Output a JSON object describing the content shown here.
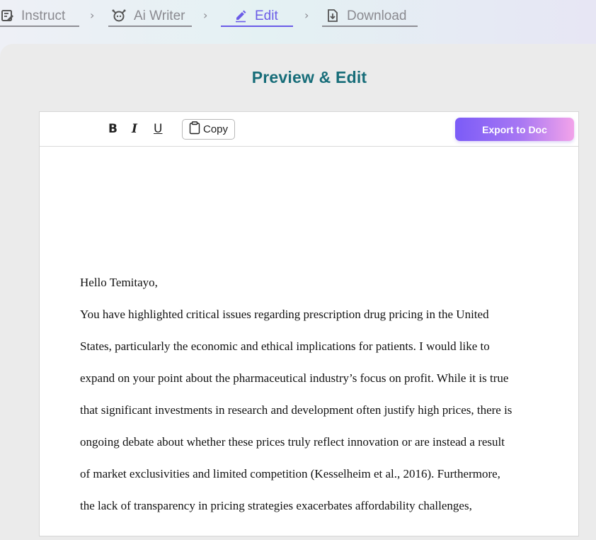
{
  "stepper": {
    "steps": [
      {
        "label": "Instruct",
        "icon": "edit-document-icon",
        "state": "done"
      },
      {
        "label": "Ai Writer",
        "icon": "robot-icon",
        "state": "done"
      },
      {
        "label": "Edit",
        "icon": "pencil-icon",
        "state": "active"
      },
      {
        "label": "Download",
        "icon": "download-document-icon",
        "state": "pending"
      }
    ],
    "separator": "›"
  },
  "page": {
    "title": "Preview & Edit"
  },
  "toolbar": {
    "bold_label": "B",
    "italic_label": "I",
    "underline_label": "U",
    "copy_label": "Copy",
    "export_label": "Export to Doc"
  },
  "document": {
    "greeting": "Hello Temitayo,",
    "lines": [
      "You have highlighted critical issues regarding prescription drug pricing in the United",
      "States, particularly the economic and ethical implications for patients. I would like to",
      "expand on your point about the pharmaceutical industry’s focus on profit. While it is true",
      "that significant investments in research and development often justify high prices, there is",
      "ongoing debate about whether these prices truly reflect innovation or are instead a result",
      "of market exclusivities and limited competition (Kesselheim et al., 2016). Furthermore,",
      "the lack of transparency in pricing strategies exacerbates affordability challenges,"
    ]
  },
  "colors": {
    "title": "#176d79",
    "active_step": "#6b5ce7",
    "inactive_step": "#8a8a90",
    "export_gradient_start": "#7b5cf7",
    "export_gradient_end": "#f2a3ea"
  }
}
